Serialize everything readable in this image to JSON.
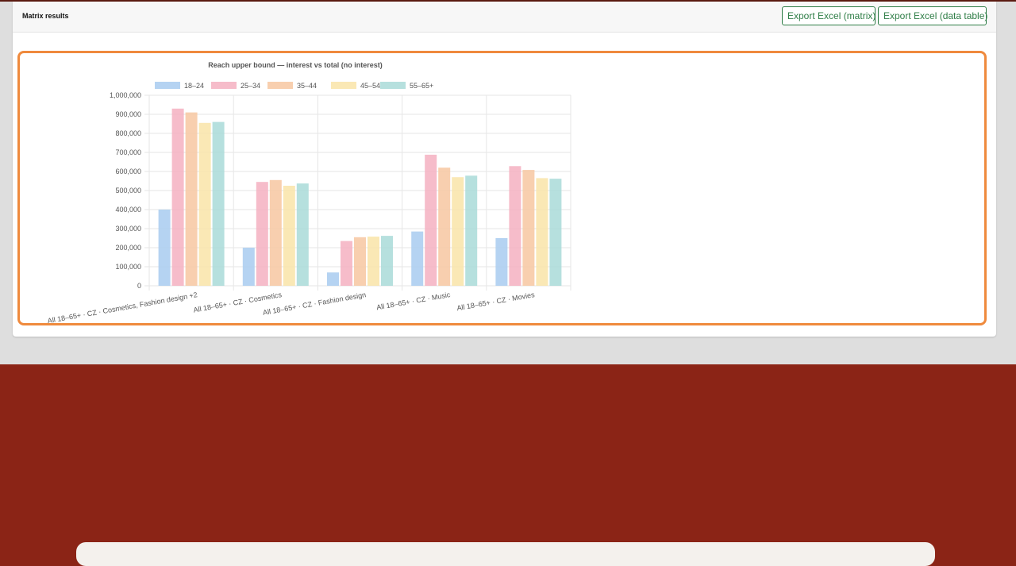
{
  "panel": {
    "title": "Matrix results",
    "buttons": {
      "export_matrix": "Export Excel (matrix)",
      "export_table": "Export Excel (data table)"
    }
  },
  "chart_data": {
    "type": "bar",
    "title": "Reach upper bound — interest vs total (no interest)",
    "xlabel": "",
    "ylabel": "",
    "ylim": [
      0,
      1000000
    ],
    "yticks": [
      0,
      100000,
      200000,
      300000,
      400000,
      500000,
      600000,
      700000,
      800000,
      900000,
      1000000
    ],
    "yticklabels": [
      "0",
      "100,000",
      "200,000",
      "300,000",
      "400,000",
      "500,000",
      "600,000",
      "700,000",
      "800,000",
      "900,000",
      "1,000,000"
    ],
    "legend_position": "top",
    "grid": true,
    "categories": [
      "All 18–65+ · CZ · Cosmetics, Fashion design +2",
      "All 18–65+ · CZ · Cosmetics",
      "All 18–65+ · CZ · Fashion design",
      "All 18–65+ · CZ · Music",
      "All 18–65+ · CZ · Movies"
    ],
    "series": [
      {
        "name": "18–24",
        "color": "#a8cbf0",
        "values": [
          400000,
          200000,
          70000,
          285000,
          250000
        ]
      },
      {
        "name": "25–34",
        "color": "#f4b0c1",
        "values": [
          930000,
          545000,
          235000,
          688000,
          628000
        ]
      },
      {
        "name": "35–44",
        "color": "#f7c7a1",
        "values": [
          910000,
          555000,
          255000,
          620000,
          608000
        ]
      },
      {
        "name": "45–54",
        "color": "#f9e4a8",
        "values": [
          855000,
          525000,
          258000,
          570000,
          565000
        ]
      },
      {
        "name": "55–65+",
        "color": "#a9dbd8",
        "values": [
          860000,
          537000,
          262000,
          578000,
          562000
        ]
      }
    ]
  }
}
